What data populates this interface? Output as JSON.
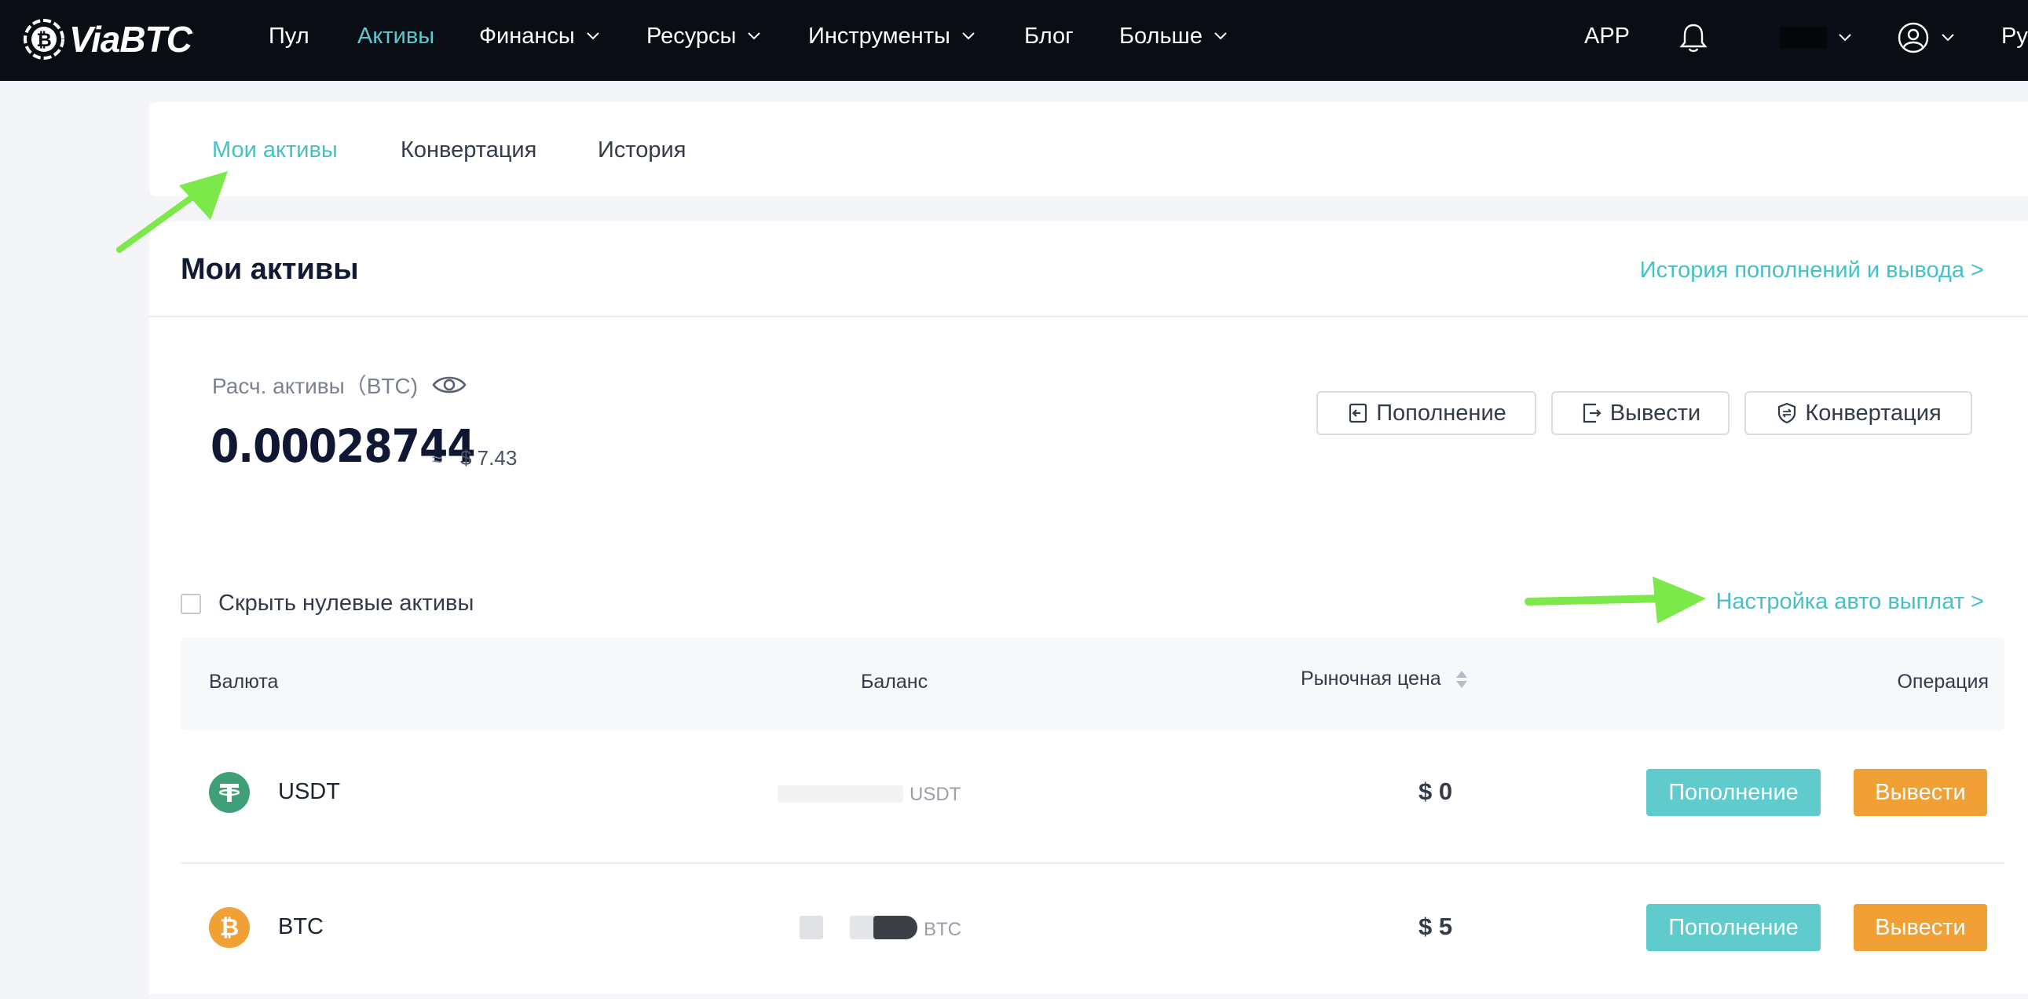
{
  "app": {
    "logo_text": "ViaBTC",
    "accent_color": "#45c1c6",
    "nav": [
      {
        "label": "Пул",
        "active": false
      },
      {
        "label": "Активы",
        "active": true
      },
      {
        "label": "Финансы",
        "dropdown": true
      },
      {
        "label": "Ресурсы",
        "dropdown": true
      },
      {
        "label": "Инструменты",
        "dropdown": true
      },
      {
        "label": "Блог",
        "active": false
      },
      {
        "label": "Больше",
        "dropdown": true
      }
    ],
    "right": {
      "app_label": "APP",
      "lang_label": "Ру"
    }
  },
  "tabs": [
    {
      "label": "Мои активы",
      "active": true
    },
    {
      "label": "Конвертация",
      "active": false
    },
    {
      "label": "История",
      "active": false
    }
  ],
  "assets": {
    "title": "Мои активы",
    "history_link": "История пополнений и вывода >",
    "estimate_label": "Расч. активы（BTC)",
    "estimate_value": "0.00028744",
    "approx_sign": "≈",
    "usd_value": "$ 7.43",
    "buttons": {
      "deposit": "Пополнение",
      "withdraw": "Вывести",
      "convert": "Конвертация"
    },
    "hide_zero_label": "Скрыть нулевые активы",
    "auto_payout_link": "Настройка авто выплат >"
  },
  "table": {
    "headers": {
      "currency": "Валюта",
      "balance": "Баланс",
      "market_price": "Рыночная цена",
      "operation": "Операция"
    },
    "rows": [
      {
        "coin": "USDT",
        "unit": "USDT",
        "price": "$ 0",
        "deposit": "Пополнение",
        "withdraw": "Вывести",
        "icon": "tether-icon",
        "color": "#3f9f77"
      },
      {
        "coin": "BTC",
        "unit": "BTC",
        "price": "$ 5",
        "deposit": "Пополнение",
        "withdraw": "Вывести",
        "icon": "bitcoin-icon",
        "color": "#f0a035"
      }
    ]
  },
  "annotation_color": "#7ce84a"
}
